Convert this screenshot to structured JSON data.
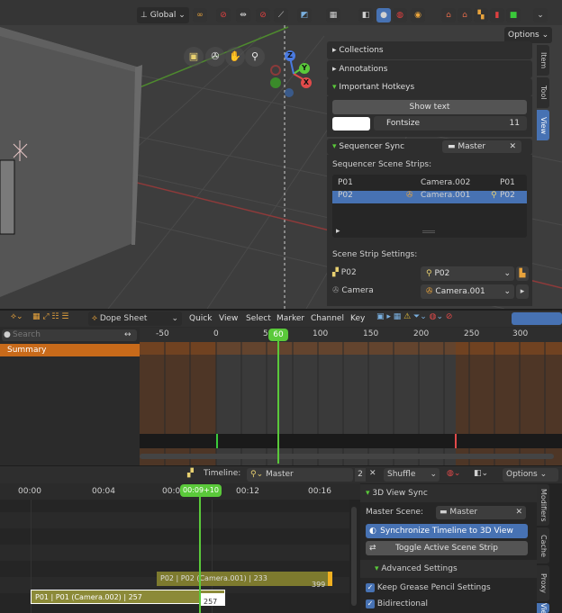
{
  "viewport": {
    "header": {
      "orientation": "Global",
      "options": "Options"
    },
    "panel_tabs": [
      "Item",
      "Tool",
      "View"
    ],
    "collections": "Collections",
    "annotations": "Annotations",
    "important_hotkeys": {
      "title": "Important Hotkeys",
      "show_text": "Show text",
      "fontsize_label": "Fontsize",
      "fontsize_value": "11"
    },
    "sequencer_sync": {
      "title": "Sequencer Sync",
      "master": "Master",
      "strips_label": "Sequencer Scene Strips:",
      "rows": [
        {
          "name": "P01",
          "camera": "Camera.002",
          "scene": "P01"
        },
        {
          "name": "P02",
          "camera": "Camera.001",
          "scene": "P02"
        }
      ],
      "settings_label": "Scene Strip Settings:",
      "setting_scene_label": "P02",
      "setting_scene_value": "P02",
      "setting_camera_label": "Camera",
      "setting_camera_value": "Camera.001"
    },
    "axes": {
      "x": "X",
      "y": "Y",
      "z": "Z"
    }
  },
  "dopesheet": {
    "mode": "Dope Sheet",
    "menus": [
      "Quick",
      "View",
      "Select",
      "Marker",
      "Channel",
      "Key"
    ],
    "search_placeholder": "Search",
    "summary": "Summary",
    "ruler": [
      "-50",
      "0",
      "50",
      "100",
      "150",
      "200",
      "250",
      "300"
    ],
    "current_frame": "60"
  },
  "sequencer": {
    "timeline_label": "Timeline:",
    "master": "Master",
    "users": "2",
    "shuffle": "Shuffle",
    "options": "Options",
    "ruler": [
      "00:00",
      "00:04",
      "00:0",
      "00:12",
      "00:16"
    ],
    "current_time": "00:09+10",
    "strip_p02": "P02 | P02 (Camera.001) | 233",
    "strip_p02_end": "399",
    "strip_p01": "P01 | P01 (Camera.002) | 257",
    "strip_p01_end": "257",
    "panel": {
      "title": "3D View Sync",
      "master_label": "Master Scene:",
      "master_value": "Master",
      "sync_button": "Synchronize Timeline to 3D View",
      "toggle_button": "Toggle Active Scene Strip",
      "advanced": "Advanced Settings",
      "keep_gp": "Keep Grease Pencil Settings",
      "bidirectional": "Bidirectional"
    },
    "tabs": [
      "Modifiers",
      "Cache",
      "Proxy",
      "View"
    ]
  },
  "colors": {
    "accent": "#4772b3",
    "playhead": "#5ac93a",
    "orange": "#b35a1a",
    "strip_p02": "#7d7a2e",
    "strip_p01": "#8c8a38"
  }
}
